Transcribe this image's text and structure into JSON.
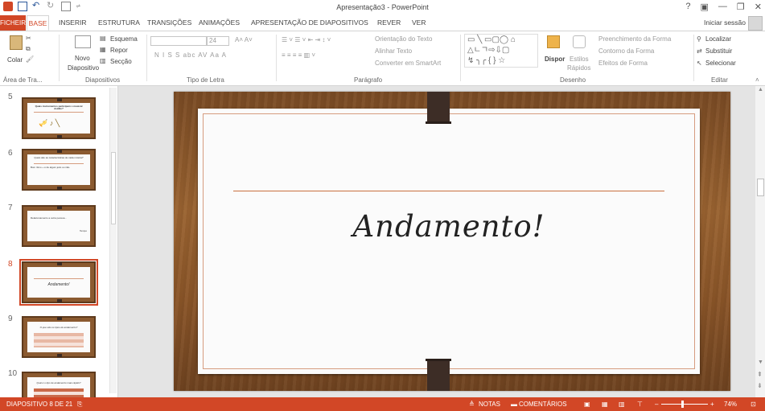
{
  "window": {
    "title": "Apresentação3 - PowerPoint",
    "controls": [
      "?",
      "▣",
      "—",
      "❐",
      "✕"
    ]
  },
  "tabs": {
    "file": "FICHEIRO",
    "items": [
      "BASE",
      "INSERIR",
      "ESTRUTURA",
      "TRANSIÇÕES",
      "ANIMAÇÕES",
      "APRESENTAÇÃO DE DIAPOSITIVOS",
      "REVER",
      "VER"
    ],
    "active": "BASE",
    "signin": "Iniciar sessão"
  },
  "ribbon": {
    "clipboard": {
      "paste": "Colar",
      "label": "Área de Tra..."
    },
    "slides": {
      "new_slide_line1": "Novo",
      "new_slide_line2": "Diapositivo",
      "layout": "Esquema",
      "reset": "Repor",
      "section": "Secção",
      "label": "Diapositivos"
    },
    "font": {
      "size": "24",
      "format_buttons": "N  I  S  S  abc  AV  Aa  A",
      "label": "Tipo de Letra"
    },
    "paragraph": {
      "text_direction": "Orientação do Texto",
      "align_text": "Alinhar Texto",
      "convert_smartart": "Converter em SmartArt",
      "label": "Parágrafo"
    },
    "drawing": {
      "arrange": "Dispor",
      "quick_styles_line1": "Estilos",
      "quick_styles_line2": "Rápidos",
      "shape_fill": "Preenchimento da Forma",
      "shape_outline": "Contorno da Forma",
      "shape_effects": "Efeitos de Forma",
      "label": "Desenho"
    },
    "editing": {
      "find": "Localizar",
      "replace": "Substituir",
      "select": "Selecionar",
      "label": "Editar"
    }
  },
  "thumbnails": [
    {
      "num": "5",
      "title": "Quais instrumentos participam o musical doidão?"
    },
    {
      "num": "6",
      "title": "Quais são as características de cada música?",
      "body": "Bom ritmo + é de algum jeito ou não."
    },
    {
      "num": "7",
      "title": "Relacionamento a outra pessoa...",
      "body": "Tempo"
    },
    {
      "num": "8",
      "title": "Andamento!",
      "selected": true
    },
    {
      "num": "9",
      "title": "O que são os tipos de andamento?"
    },
    {
      "num": "10",
      "title": "Qual é o tipo de andamento mais rápido?"
    }
  ],
  "slide": {
    "title": "Andamento!"
  },
  "statusbar": {
    "slide_info": "DIAPOSITIVO 8 DE 21",
    "notes": "NOTAS",
    "comments": "COMENTÁRIOS",
    "zoom": "74%"
  },
  "colors": {
    "accent": "#d24726",
    "wood": "#8a5528",
    "paper": "#fbfbfb",
    "rule": "#c9703f"
  }
}
